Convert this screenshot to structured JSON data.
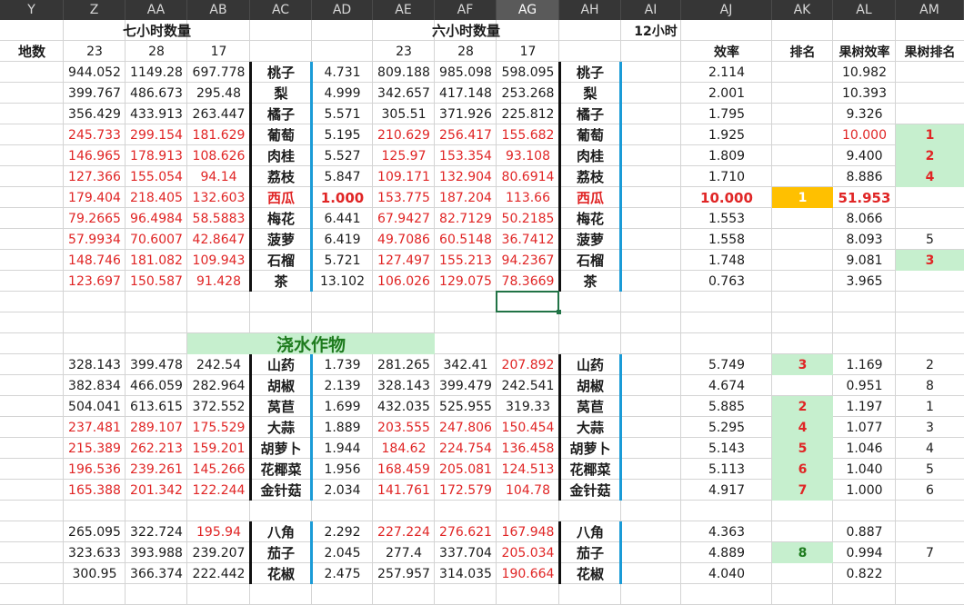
{
  "column_headers": [
    {
      "label": "Y",
      "active": false
    },
    {
      "label": "Z",
      "active": false
    },
    {
      "label": "AA",
      "active": false
    },
    {
      "label": "AB",
      "active": false
    },
    {
      "label": "AC",
      "active": false
    },
    {
      "label": "AD",
      "active": false
    },
    {
      "label": "AE",
      "active": false
    },
    {
      "label": "AF",
      "active": false
    },
    {
      "label": "AG",
      "active": true
    },
    {
      "label": "AH",
      "active": false
    },
    {
      "label": "AI",
      "active": false
    },
    {
      "label": "AJ",
      "active": false
    },
    {
      "label": "AK",
      "active": false
    },
    {
      "label": "AL",
      "active": false
    },
    {
      "label": "AM",
      "active": false
    }
  ],
  "headings": {
    "seven_hour_qty": "七小时数量",
    "six_hour_qty": "六小时数量",
    "twelve_hour": "12小时",
    "plot_count": "地数",
    "efficiency": "效率",
    "rank": "排名",
    "fruit_tree_efficiency": "果树效率",
    "fruit_tree_rank": "果树排名",
    "ze_23": "23",
    "aa_28": "28",
    "ab_17": "17",
    "ae_23": "23",
    "af_28": "28",
    "ag_17": "17",
    "watering_crops": "浇水作物"
  },
  "colors": {
    "red_text": "#e02525",
    "green_text": "#1e7b1e",
    "rank_red": "#e02525",
    "light_green_fill": "#c6efce",
    "orange_fill": "#ffc000",
    "divider_black": "#111111",
    "divider_blue": "#1a9bd7"
  },
  "rows": [
    {
      "z": "944.052",
      "aa": "1149.28",
      "ab": "697.778",
      "name": "桃子",
      "ad": "4.731",
      "ae": "809.188",
      "af": "985.098",
      "ag": "598.095",
      "name2": "桃子",
      "aj": "2.114",
      "ak": "",
      "al": "10.982",
      "am": "",
      "style": "normal"
    },
    {
      "z": "399.767",
      "aa": "486.673",
      "ab": "295.48",
      "name": "梨",
      "ad": "4.999",
      "ae": "342.657",
      "af": "417.148",
      "ag": "253.268",
      "name2": "梨",
      "aj": "2.001",
      "ak": "",
      "al": "10.393",
      "am": "",
      "style": "normal"
    },
    {
      "z": "356.429",
      "aa": "433.913",
      "ab": "263.447",
      "name": "橘子",
      "ad": "5.571",
      "ae": "305.51",
      "af": "371.926",
      "ag": "225.812",
      "name2": "橘子",
      "aj": "1.795",
      "ak": "",
      "al": "9.326",
      "am": "",
      "style": "normal"
    },
    {
      "z": "245.733",
      "aa": "299.154",
      "ab": "181.629",
      "name": "葡萄",
      "ad": "5.195",
      "ae": "210.629",
      "af": "256.417",
      "ag": "155.682",
      "name2": "葡萄",
      "aj": "1.925",
      "ak": "",
      "al": "10.000",
      "am": "1",
      "style": "red",
      "al_red": true,
      "am_rank": true
    },
    {
      "z": "146.965",
      "aa": "178.913",
      "ab": "108.626",
      "name": "肉桂",
      "ad": "5.527",
      "ae": "125.97",
      "af": "153.354",
      "ag": "93.108",
      "name2": "肉桂",
      "aj": "1.809",
      "ak": "",
      "al": "9.400",
      "am": "2",
      "style": "red",
      "am_rank": true
    },
    {
      "z": "127.366",
      "aa": "155.054",
      "ab": "94.14",
      "name": "荔枝",
      "ad": "5.847",
      "ae": "109.171",
      "af": "132.904",
      "ag": "80.6914",
      "name2": "荔枝",
      "aj": "1.710",
      "ak": "",
      "al": "8.886",
      "am": "4",
      "style": "red",
      "am_rank": true
    },
    {
      "z": "179.404",
      "aa": "218.405",
      "ab": "132.603",
      "name": "西瓜",
      "ad": "1.000",
      "ae": "153.775",
      "af": "187.204",
      "ag": "113.66",
      "name2": "西瓜",
      "aj": "10.000",
      "ak": "1",
      "al": "51.953",
      "am": "",
      "style": "red",
      "watermelon": true
    },
    {
      "z": "79.2665",
      "aa": "96.4984",
      "ab": "58.5883",
      "name": "梅花",
      "ad": "6.441",
      "ae": "67.9427",
      "af": "82.7129",
      "ag": "50.2185",
      "name2": "梅花",
      "aj": "1.553",
      "ak": "",
      "al": "8.066",
      "am": "",
      "style": "red"
    },
    {
      "z": "57.9934",
      "aa": "70.6007",
      "ab": "42.8647",
      "name": "菠萝",
      "ad": "6.419",
      "ae": "49.7086",
      "af": "60.5148",
      "ag": "36.7412",
      "name2": "菠萝",
      "aj": "1.558",
      "ak": "",
      "al": "8.093",
      "am": "5",
      "style": "red",
      "am_plain": true
    },
    {
      "z": "148.746",
      "aa": "181.082",
      "ab": "109.943",
      "name": "石榴",
      "ad": "5.721",
      "ae": "127.497",
      "af": "155.213",
      "ag": "94.2367",
      "name2": "石榴",
      "aj": "1.748",
      "ak": "",
      "al": "9.081",
      "am": "3",
      "style": "red",
      "am_rank": true
    },
    {
      "z": "123.697",
      "aa": "150.587",
      "ab": "91.428",
      "name": "茶",
      "ad": "13.102",
      "ae": "106.026",
      "af": "129.075",
      "ag": "78.3669",
      "name2": "茶",
      "aj": "0.763",
      "ak": "",
      "al": "3.965",
      "am": "",
      "style": "red"
    },
    {
      "blank": true
    },
    {
      "blank": true
    },
    {
      "title": true
    },
    {
      "z": "328.143",
      "aa": "399.478",
      "ab": "242.54",
      "name": "山药",
      "ad": "1.739",
      "ae": "281.265",
      "af": "342.41",
      "ag": "207.892",
      "name2": "山药",
      "aj": "5.749",
      "ak": "3",
      "al": "1.169",
      "am": "2",
      "style": "normal",
      "ag_red": true
    },
    {
      "z": "382.834",
      "aa": "466.059",
      "ab": "282.964",
      "name": "胡椒",
      "ad": "2.139",
      "ae": "328.143",
      "af": "399.479",
      "ag": "242.541",
      "name2": "胡椒",
      "aj": "4.674",
      "ak": "",
      "al": "0.951",
      "am": "8",
      "style": "normal"
    },
    {
      "z": "504.041",
      "aa": "613.615",
      "ab": "372.552",
      "name": "莴苣",
      "ad": "1.699",
      "ae": "432.035",
      "af": "525.955",
      "ag": "319.33",
      "name2": "莴苣",
      "aj": "5.885",
      "ak": "2",
      "al": "1.197",
      "am": "1",
      "style": "normal"
    },
    {
      "z": "237.481",
      "aa": "289.107",
      "ab": "175.529",
      "name": "大蒜",
      "ad": "1.889",
      "ae": "203.555",
      "af": "247.806",
      "ag": "150.454",
      "name2": "大蒜",
      "aj": "5.295",
      "ak": "4",
      "al": "1.077",
      "am": "3",
      "style": "red"
    },
    {
      "z": "215.389",
      "aa": "262.213",
      "ab": "159.201",
      "name": "胡萝卜",
      "ad": "1.944",
      "ae": "184.62",
      "af": "224.754",
      "ag": "136.458",
      "name2": "胡萝卜",
      "aj": "5.143",
      "ak": "5",
      "al": "1.046",
      "am": "4",
      "style": "red"
    },
    {
      "z": "196.536",
      "aa": "239.261",
      "ab": "145.266",
      "name": "花椰菜",
      "ad": "1.956",
      "ae": "168.459",
      "af": "205.081",
      "ag": "124.513",
      "name2": "花椰菜",
      "aj": "5.113",
      "ak": "6",
      "al": "1.040",
      "am": "5",
      "style": "red"
    },
    {
      "z": "165.388",
      "aa": "201.342",
      "ab": "122.244",
      "name": "金针菇",
      "ad": "2.034",
      "ae": "141.761",
      "af": "172.579",
      "ag": "104.78",
      "name2": "金针菇",
      "aj": "4.917",
      "ak": "7",
      "al": "1.000",
      "am": "6",
      "style": "red"
    },
    {
      "blank": true
    },
    {
      "z": "265.095",
      "aa": "322.724",
      "ab": "195.94",
      "name": "八角",
      "ad": "2.292",
      "ae": "227.224",
      "af": "276.621",
      "ag": "167.948",
      "name2": "八角",
      "aj": "4.363",
      "ak": "",
      "al": "0.887",
      "am": "",
      "style": "normal",
      "ab_red": true,
      "ae_red": true,
      "af_red": true,
      "ag_red": true
    },
    {
      "z": "323.633",
      "aa": "393.988",
      "ab": "239.207",
      "name": "茄子",
      "ad": "2.045",
      "ae": "277.4",
      "af": "337.704",
      "ag": "205.034",
      "name2": "茄子",
      "aj": "4.889",
      "ak": "8",
      "al": "0.994",
      "am": "7",
      "style": "normal",
      "ag_red": true,
      "ak_green": true
    },
    {
      "z": "300.95",
      "aa": "366.374",
      "ab": "222.442",
      "name": "花椒",
      "ad": "2.475",
      "ae": "257.957",
      "af": "314.035",
      "ag": "190.664",
      "name2": "花椒",
      "aj": "4.040",
      "ak": "",
      "al": "0.822",
      "am": "",
      "style": "normal",
      "ag_red": true
    }
  ]
}
